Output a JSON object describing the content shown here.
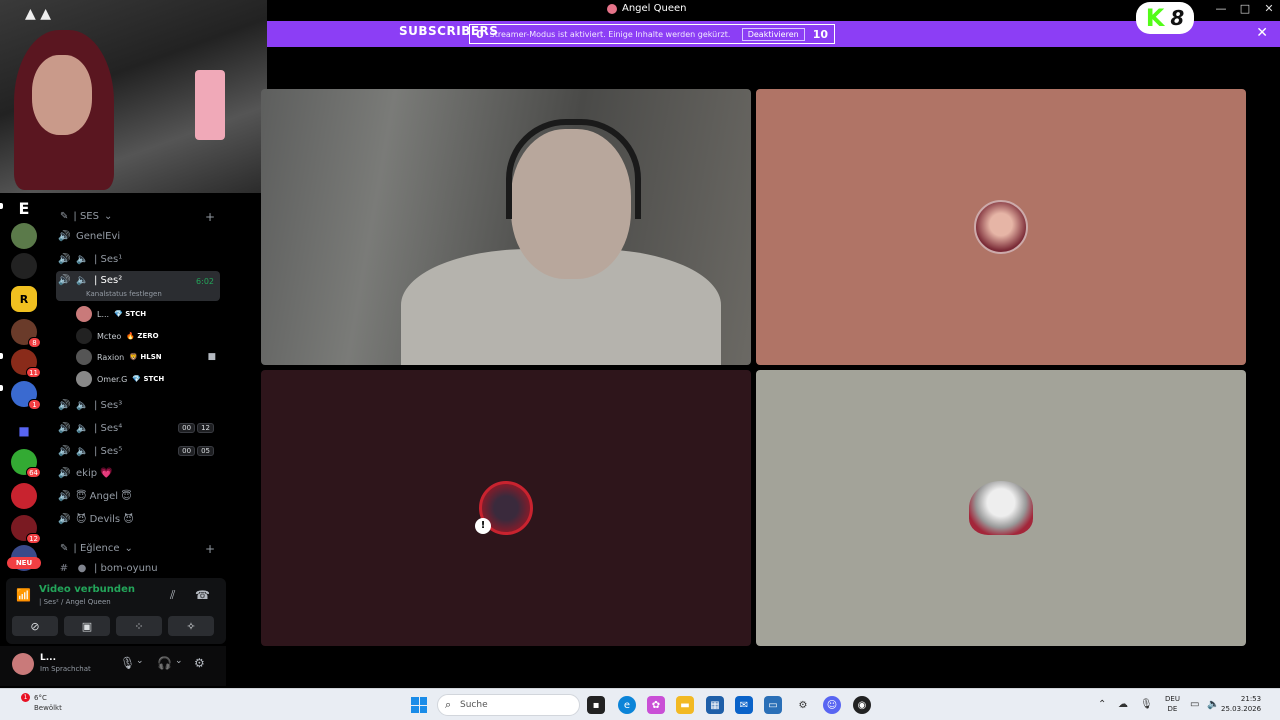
{
  "window": {
    "title": "Angel Queen",
    "controls": [
      "—",
      "□",
      "✕"
    ]
  },
  "banner": {
    "left_count": "0",
    "message": "Streamer-Modus ist aktiviert. Einige Inhalte werden gekürzt.",
    "overlay_text": "SUBSCRIBERS",
    "deactivate_label": "Deaktivieren",
    "right_count": "10",
    "close_icon": "close-icon",
    "color": "#8c3ef5"
  },
  "kick_badge": {
    "k": "K",
    "count": "8"
  },
  "servers": {
    "top_letter": "E",
    "badges": [
      "8",
      "11",
      "1",
      "64",
      "12"
    ],
    "new_label": "NEU"
  },
  "channels": {
    "category_voice": "| SES",
    "category_fun": "| Eğlence",
    "items": [
      {
        "name": "GenelEvi"
      },
      {
        "name": "| Ses¹"
      },
      {
        "name": "| Ses²",
        "time": "6:02",
        "status": "Kanalstatus festlegen"
      },
      {
        "name": "| Ses³"
      },
      {
        "name": "| Ses⁴",
        "pill_a": "00",
        "pill_b": "12"
      },
      {
        "name": "| Ses⁵",
        "pill_a": "00",
        "pill_b": "05"
      },
      {
        "name": "ekip 💗"
      },
      {
        "name": "😇 Angel 😇"
      },
      {
        "name": "😈 Devils 😈"
      },
      {
        "name": "| bom-oyunu"
      }
    ],
    "voice_users": [
      {
        "name": "L...",
        "tag": "💎 STCH"
      },
      {
        "name": "Mcteo",
        "tag": "🔥 ZERO"
      },
      {
        "name": "Raxion",
        "tag": "🦁 HLSN"
      },
      {
        "name": "Omer.G",
        "tag": "💎 STCH"
      }
    ]
  },
  "voice_panel": {
    "title": "Video verbunden",
    "subtitle": "| Ses² / Angel Queen"
  },
  "user_panel": {
    "name": "L...",
    "status": "Im Sprachchat"
  },
  "taskbar": {
    "weather_temp": "6°C",
    "weather_desc": "Bewölkt",
    "weather_alert": "1",
    "search_placeholder": "Suche",
    "lang_top": "DEU",
    "lang_bottom": "DE",
    "time": "21:53",
    "date": "25.03.2026"
  }
}
